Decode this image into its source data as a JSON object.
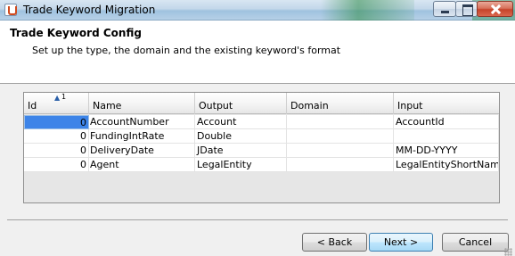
{
  "window": {
    "title": "Trade Keyword Migration",
    "app_icon": "java-cup-icon"
  },
  "header": {
    "title": "Trade Keyword Config",
    "description": "Set up the type, the domain and the existing keyword's format"
  },
  "table": {
    "columns": [
      "Id",
      "Name",
      "Output",
      "Domain",
      "Input"
    ],
    "sort": {
      "indicator": "▲",
      "order": "1"
    },
    "rows": [
      {
        "id": "0",
        "name": "AccountNumber",
        "output": "Account",
        "domain": "",
        "input": "AccountId"
      },
      {
        "id": "0",
        "name": "FundingIntRate",
        "output": "Double",
        "domain": "",
        "input": ""
      },
      {
        "id": "0",
        "name": "DeliveryDate",
        "output": "JDate",
        "domain": "",
        "input": "MM-DD-YYYY"
      },
      {
        "id": "0",
        "name": "Agent",
        "output": "LegalEntity",
        "domain": "",
        "input": "LegalEntityShortName"
      }
    ]
  },
  "footer": {
    "back_label": "< Back",
    "next_label": "Next >",
    "cancel_label": "Cancel"
  },
  "colors": {
    "selection": "#3d84e8",
    "titlebar": "#c3d7ea",
    "close_button": "#c5432a"
  }
}
